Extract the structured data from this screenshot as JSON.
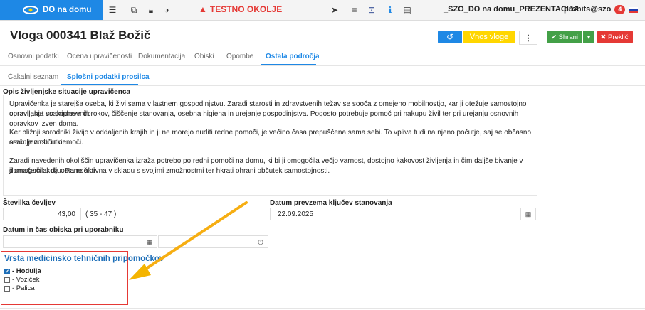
{
  "topbar": {
    "brand": "DO na domu",
    "testno": "TESTNO OKOLJE",
    "environment": "_SZO_DO na domu_PREZENTACIJA",
    "user": "probits@szo",
    "notification_count": "4"
  },
  "header": {
    "title": "Vloga 000341 Blaž Božič",
    "vnos_label": "Vnos vloge",
    "shrani_label": "Shrani",
    "preklici_label": "Prekliči"
  },
  "tabs": [
    {
      "label": "Osnovni podatki"
    },
    {
      "label": "Ocena upravičenosti"
    },
    {
      "label": "Dokumentacija"
    },
    {
      "label": "Obiski"
    },
    {
      "label": "Opombe"
    },
    {
      "label": "Ostala področja"
    }
  ],
  "subtabs": [
    {
      "label": "Čakalni seznam"
    },
    {
      "label": "Splošni podatki prosilca"
    }
  ],
  "opis": {
    "label": "Opis življenjske situacije upravičenca",
    "lines": [
      "Upravičenka je starejša oseba, ki živi sama v lastnem gospodinjstvu. Zaradi starosti in zdravstvenih težav se sooča z omejeno mobilnostjo, kar ji otežuje samostojno opravljanje vsakodnevnih",
      "opravil, kot so priprava obrokov, čiščenje stanovanja, osebna higiena in urejanje gospodinjstva. Pogosto potrebuje pomoč pri nakupu živil ter pri urejanju osnovnih opravkov izven doma.",
      "Ker bližnji sorodniki živijo v oddaljenih krajih in ji ne morejo nuditi redne pomoči, je večino časa prepuščena sama sebi. To vpliva tudi na njeno počutje, saj se občasno srečuje z občutki",
      "osamljenosti in nemoči.",
      "Zaradi navedenih okoliščin upravičenka izraža potrebo po redni pomoči na domu, ki bi ji omogočila večjo varnost, dostojno kakovost življenja in čim daljše bivanje v domačem okolju. Pomoč bi",
      "ji omogočila, da ostane aktivna v skladu s svojimi zmožnostmi ter hkrati ohrani občutek samostojnosti."
    ]
  },
  "fields": {
    "stevilka_cevljev_label": "Številka čevljev",
    "stevilka_cevljev_value": "43,00",
    "stevilka_cevljev_range": "( 35 - 47 )",
    "datum_kljucev_label": "Datum prevzema ključev stanovanja",
    "datum_kljucev_value": "22.09.2025",
    "datum_obiska_label": "Datum in čas obiska pri uporabniku"
  },
  "medicinski": {
    "title": "Vrsta medicinsko tehničnih pripomočkov",
    "items": [
      {
        "label": "- Hodulja",
        "checked": true
      },
      {
        "label": "- Voziček",
        "checked": false
      },
      {
        "label": "- Palica",
        "checked": false
      }
    ]
  },
  "colors": {
    "primary": "#1e88e5",
    "warning": "#ffd600",
    "success": "#43a047",
    "danger": "#e53935",
    "highlight_arrow": "#f4b400"
  }
}
